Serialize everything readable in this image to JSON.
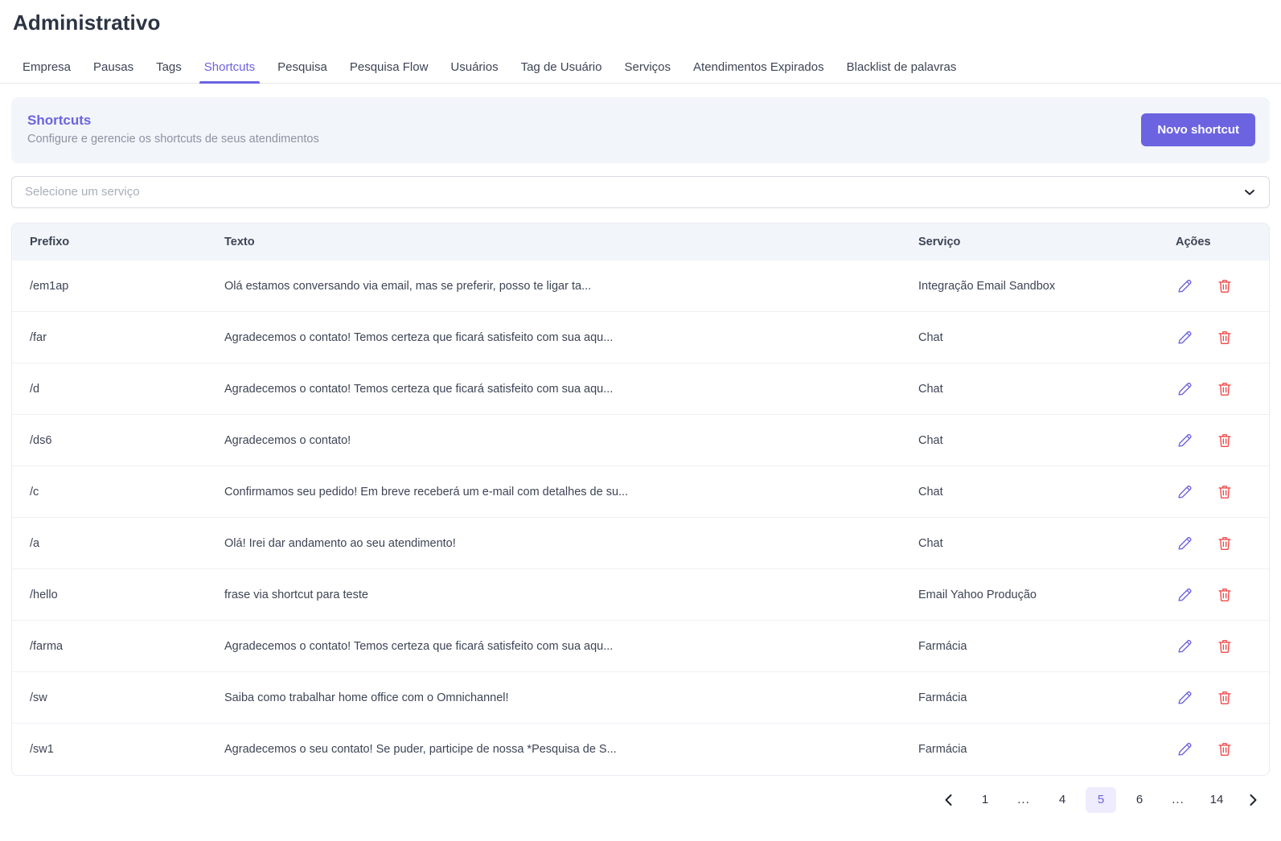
{
  "page": {
    "title": "Administrativo"
  },
  "tabs": [
    {
      "label": "Empresa",
      "active": false
    },
    {
      "label": "Pausas",
      "active": false
    },
    {
      "label": "Tags",
      "active": false
    },
    {
      "label": "Shortcuts",
      "active": true
    },
    {
      "label": "Pesquisa",
      "active": false
    },
    {
      "label": "Pesquisa Flow",
      "active": false
    },
    {
      "label": "Usuários",
      "active": false
    },
    {
      "label": "Tag de Usuário",
      "active": false
    },
    {
      "label": "Serviços",
      "active": false
    },
    {
      "label": "Atendimentos Expirados",
      "active": false
    },
    {
      "label": "Blacklist de palavras",
      "active": false
    }
  ],
  "header_card": {
    "title": "Shortcuts",
    "subtitle": "Configure e gerencie os shortcuts de seus atendimentos",
    "new_button_label": "Novo shortcut"
  },
  "service_filter": {
    "placeholder": "Selecione um serviço",
    "value": "",
    "icon": "chevron-down-icon"
  },
  "table": {
    "columns": [
      "Prefixo",
      "Texto",
      "Serviço",
      "Ações"
    ],
    "row_actions": {
      "edit_icon": "pencil-icon",
      "delete_icon": "trash-icon"
    },
    "rows": [
      {
        "prefixo": "/em1ap",
        "texto": "Olá estamos conversando via email, mas se preferir, posso te ligar ta...",
        "servico": "Integração Email Sandbox"
      },
      {
        "prefixo": "/far",
        "texto": "Agradecemos o contato! Temos certeza que ficará satisfeito com sua aqu...",
        "servico": "Chat"
      },
      {
        "prefixo": "/d",
        "texto": "Agradecemos o contato! Temos certeza que ficará satisfeito com sua aqu...",
        "servico": "Chat"
      },
      {
        "prefixo": "/ds6",
        "texto": "Agradecemos o contato!",
        "servico": "Chat"
      },
      {
        "prefixo": "/c",
        "texto": "Confirmamos seu pedido! Em breve receberá um e-mail com detalhes de su...",
        "servico": "Chat"
      },
      {
        "prefixo": "/a",
        "texto": "Olá! Irei dar andamento ao seu atendimento!",
        "servico": "Chat"
      },
      {
        "prefixo": "/hello",
        "texto": "frase via shortcut para teste",
        "servico": "Email Yahoo Produção"
      },
      {
        "prefixo": "/farma",
        "texto": "Agradecemos o contato! Temos certeza que ficará satisfeito com sua aqu...",
        "servico": "Farmácia"
      },
      {
        "prefixo": "/sw",
        "texto": "Saiba como trabalhar home office com o Omnichannel!",
        "servico": "Farmácia"
      },
      {
        "prefixo": "/sw1",
        "texto": "Agradecemos o seu contato! Se puder, participe de nossa *Pesquisa de S...",
        "servico": "Farmácia"
      }
    ]
  },
  "pagination": {
    "prev_icon": "chevron-left-icon",
    "next_icon": "chevron-right-icon",
    "current_page": 5,
    "total_pages": 14,
    "items": [
      {
        "label": "1",
        "active": false,
        "ellipsis": false
      },
      {
        "label": "...",
        "active": false,
        "ellipsis": true
      },
      {
        "label": "4",
        "active": false,
        "ellipsis": false
      },
      {
        "label": "5",
        "active": true,
        "ellipsis": false
      },
      {
        "label": "6",
        "active": false,
        "ellipsis": false
      },
      {
        "label": "...",
        "active": false,
        "ellipsis": true
      },
      {
        "label": "14",
        "active": false,
        "ellipsis": false
      }
    ]
  },
  "colors": {
    "accent": "#6c63e0",
    "accent_soft": "#eeecfd",
    "panel": "#f2f5fa",
    "text": "#3d4455",
    "muted": "#8e93a1",
    "danger": "#f04a4a",
    "border": "#e9ecf1"
  }
}
